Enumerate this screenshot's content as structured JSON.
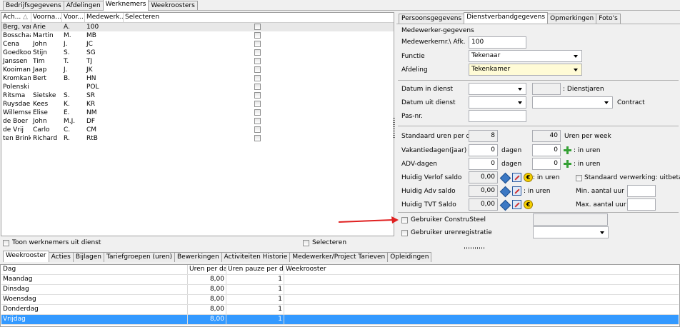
{
  "top_tabs": [
    "Bedrijfsgegevens",
    "Afdelingen",
    "Werknemers",
    "Weekroosters"
  ],
  "top_tab_active": 2,
  "employee_grid": {
    "columns": [
      "Ach...",
      "Voorna...",
      "Voor...",
      "Medewerk...",
      "Selecteren"
    ],
    "rows": [
      {
        "achternaam": "Berg, van",
        "voornaam": "Arie",
        "voorletters": "A.",
        "code": "100",
        "selected": true
      },
      {
        "achternaam": "Bosschaar",
        "voornaam": "Martin",
        "voorletters": "M.",
        "code": "MB"
      },
      {
        "achternaam": "Cena",
        "voornaam": "John",
        "voorletters": "J.",
        "code": "JC"
      },
      {
        "achternaam": "Goedkoop",
        "voornaam": "Stijn",
        "voorletters": "S.",
        "code": "SG"
      },
      {
        "achternaam": "Janssen",
        "voornaam": "Tim",
        "voorletters": "T.",
        "code": "TJ"
      },
      {
        "achternaam": "Kooiman",
        "voornaam": "Jaap",
        "voorletters": "J.",
        "code": "JK"
      },
      {
        "achternaam": "Kromkamp",
        "voornaam": "Bert",
        "voorletters": "B.",
        "code": "HN"
      },
      {
        "achternaam": "Polenski",
        "voornaam": "",
        "voorletters": "",
        "code": "POL"
      },
      {
        "achternaam": "Ritsma",
        "voornaam": "Sietske",
        "voorletters": "S.",
        "code": "SR"
      },
      {
        "achternaam": "Ruysdael",
        "voornaam": "Kees",
        "voorletters": "K.",
        "code": "KR"
      },
      {
        "achternaam": "Willemse",
        "voornaam": "Elise",
        "voorletters": "E.",
        "code": "NM"
      },
      {
        "achternaam": "de Boer",
        "voornaam": "John",
        "voorletters": "M.J.",
        "code": "DF"
      },
      {
        "achternaam": "de Vrij",
        "voornaam": "Carlo",
        "voorletters": "C.",
        "code": "CM"
      },
      {
        "achternaam": "ten Brinke",
        "voornaam": "Richard",
        "voorletters": "R.",
        "code": "RtB"
      }
    ],
    "toon_uit_dienst": "Toon werknemers uit dienst",
    "selecteren": "Selecteren"
  },
  "detail_tabs": [
    "Persoonsgegevens",
    "Dienstverbandgegevens",
    "Opmerkingen",
    "Foto's"
  ],
  "detail_tab_active": 1,
  "form": {
    "section_title": "Medewerker-gegevens",
    "medewerkernr_label": "Medewerkernr.\\ Afk.",
    "medewerkernr_value": "100",
    "functie_label": "Functie",
    "functie_value": "Tekenaar",
    "afdeling_label": "Afdeling",
    "afdeling_value": "Tekenkamer",
    "datum_in_label": "Datum in dienst",
    "dienstjaren_label": ": Dienstjaren",
    "datum_uit_label": "Datum uit dienst",
    "contract_label": "Contract",
    "pasnr_label": "Pas-nr.",
    "std_uren_dag_label": "Standaard uren per dag",
    "std_uren_dag_value": "8",
    "uren_week_value": "40",
    "uren_week_label": "Uren per week",
    "vakantie_label": "Vakantiedagen(jaar)",
    "vakantie_value": "0",
    "dagen1": "dagen",
    "vakantie_uren_value": "0",
    "in_uren1": ": in uren",
    "adv_label": "ADV-dagen",
    "adv_value": "0",
    "dagen2": "dagen",
    "adv_uren_value": "0",
    "in_uren2": ": in uren",
    "verlof_label": "Huidig Verlof saldo",
    "verlof_value": "0,00",
    "in_uren3": ": in uren",
    "std_verwerking_label": "Standaard verwerking: uitbetalen",
    "adv_saldo_label": "Huidig Adv saldo",
    "adv_saldo_value": "0,00",
    "in_uren4": ": in uren",
    "min_uur_label": "Min. aantal uur",
    "tvt_label": "Huidig TVT Saldo",
    "tvt_value": "0,00",
    "max_uur_label": "Max. aantal uur",
    "construsteel_label": "Gebruiker ConstruSteel",
    "urenreg_label": "Gebruiker urenregistratie"
  },
  "bottom_tabs": [
    "Weekrooster",
    "Acties",
    "Bijlagen",
    "Tariefgroepen (uren)",
    "Bewerkingen",
    "Activiteiten Historie",
    "Medewerker/Project Tarieven",
    "Opleidingen"
  ],
  "bottom_tab_active": 0,
  "weekrooster": {
    "columns": [
      "Dag",
      "Uren per dag",
      "Uren pauze per dag",
      "Weekrooster"
    ],
    "rows": [
      {
        "dag": "Maandag",
        "uren": "8,00",
        "pauze": "1"
      },
      {
        "dag": "Dinsdag",
        "uren": "8,00",
        "pauze": "1"
      },
      {
        "dag": "Woensdag",
        "uren": "8,00",
        "pauze": "1"
      },
      {
        "dag": "Donderdag",
        "uren": "8,00",
        "pauze": "1"
      },
      {
        "dag": "Vrijdag",
        "uren": "8,00",
        "pauze": "1"
      }
    ],
    "selected_row": 4
  },
  "colors": {
    "selection": "#3399ff",
    "arrow": "#e02020",
    "yellow_field": "#fffbd6"
  }
}
